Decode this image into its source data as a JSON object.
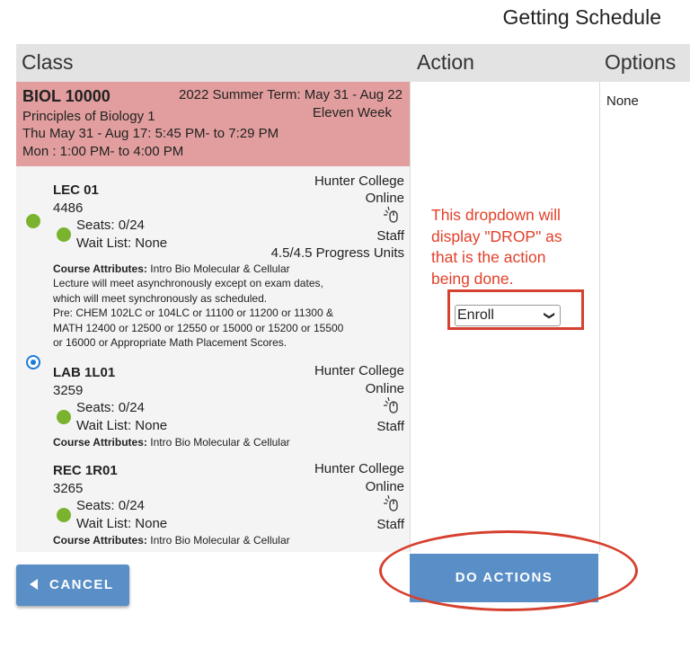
{
  "page": {
    "title": "Getting Schedule"
  },
  "columns": {
    "class": "Class",
    "action": "Action",
    "options": "Options"
  },
  "options_value": "None",
  "course": {
    "code": "BIOL 10000",
    "term": "2022 Summer Term: May 31 - Aug 22",
    "session": "Eleven Week",
    "name": "Principles of Biology 1",
    "meeting1": "Thu May 31 - Aug 17: 5:45 PM- to 7:29 PM",
    "meeting2": "Mon : 1:00 PM- to 4:00 PM"
  },
  "sections": [
    {
      "title": "LEC 01",
      "number": "4486",
      "college": "Hunter College",
      "mode": "Online",
      "seats": "Seats: 0/24",
      "waitlist": "Wait List: None",
      "instructor": "Staff",
      "units": "4.5/4.5 Progress Units",
      "attr_label": "Course Attributes:",
      "attr_value": " Intro Bio Molecular & Cellular",
      "notes": [
        "Lecture will meet asynchronously except on exam dates,",
        "which will meet synchronously as scheduled.",
        "Pre: CHEM 102LC or 104LC or 11100 or 11200 or 11300 &",
        "MATH 12400 or 12500 or 12550 or 15000 or 15200 or 15500",
        "or 16000 or Appropriate Math Placement Scores."
      ]
    },
    {
      "title": "LAB 1L01",
      "number": "3259",
      "college": "Hunter College",
      "mode": "Online",
      "seats": "Seats: 0/24",
      "waitlist": "Wait List: None",
      "instructor": "Staff",
      "attr_label": "Course Attributes:",
      "attr_value": " Intro Bio Molecular & Cellular"
    },
    {
      "title": "REC 1R01",
      "number": "3265",
      "college": "Hunter College",
      "mode": "Online",
      "seats": "Seats: 0/24",
      "waitlist": "Wait List: None",
      "instructor": "Staff",
      "attr_label": "Course Attributes:",
      "attr_value": " Intro Bio Molecular & Cellular"
    }
  ],
  "annotation": {
    "lines": [
      "This dropdown will",
      "display \"DROP\" as",
      "that is the action",
      "being done."
    ],
    "color": "#e2402a"
  },
  "action_select": {
    "value": "Enroll"
  },
  "buttons": {
    "do_actions": "DO ACTIONS",
    "cancel": "CANCEL"
  },
  "colors": {
    "course_header": "#e29e9e",
    "button": "#5a8ec7",
    "status_open": "#7ab32e",
    "radio": "#1e7ad9"
  }
}
